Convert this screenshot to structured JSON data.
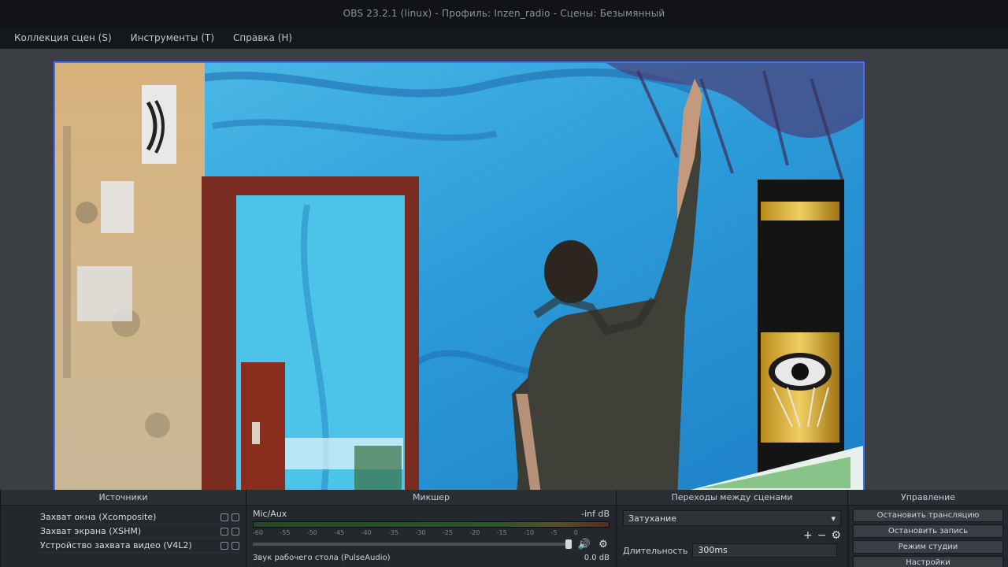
{
  "window": {
    "title": "OBS 23.2.1 (linux) - Профиль: Inzen_radio - Сцены: Безымянный"
  },
  "menu": [
    "Коллекция сцен (S)",
    "Инструменты (T)",
    "Справка (H)"
  ],
  "docks": {
    "sources": {
      "title": "Источники",
      "items": [
        "Захват окна (Xcomposite)",
        "Захват экрана (XSHM)",
        "Устройство захвата видео (V4L2)"
      ]
    },
    "mixer": {
      "title": "Микшер",
      "channel": "Mic/Aux",
      "level": "-inf dB",
      "ticks": [
        "-60",
        "-55",
        "-50",
        "-45",
        "-40",
        "-35",
        "-30",
        "-25",
        "-20",
        "-15",
        "-10",
        "-5",
        "0"
      ],
      "second_channel": "Звук рабочего стола (PulseAudio)",
      "second_level": "0.0 dB"
    },
    "transitions": {
      "title": "Переходы между сценами",
      "selected": "Затухание",
      "duration_label": "Длительность",
      "duration_value": "300ms"
    },
    "controls": {
      "title": "Управление",
      "buttons": [
        "Остановить трансляцию",
        "Остановить запись",
        "Режим студии",
        "Настройки"
      ]
    }
  },
  "colors": {
    "selection_border": "#3d73ff",
    "wall_blue": "#38a6dd"
  }
}
